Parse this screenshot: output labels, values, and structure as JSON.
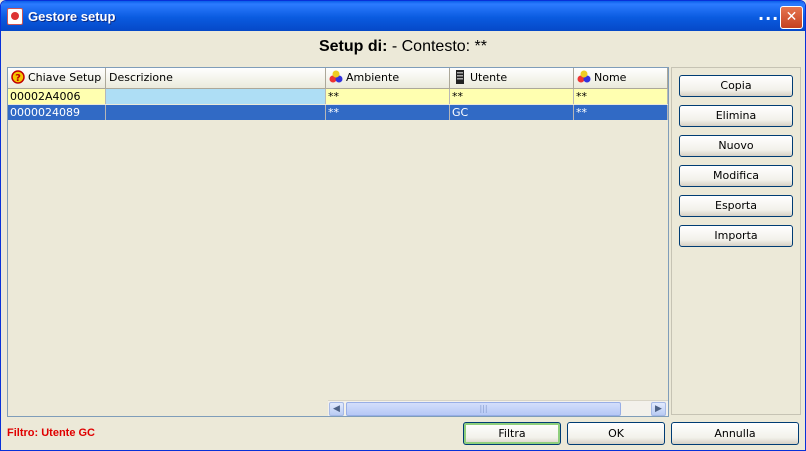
{
  "window": {
    "title": "Gestore setup",
    "menu_dots": "...",
    "close_glyph": "✕"
  },
  "heading": {
    "label": "Setup di:",
    "context": " - Contesto: **"
  },
  "table": {
    "columns": [
      {
        "label": "Chiave Setup",
        "icon": "question-icon"
      },
      {
        "label": "Descrizione",
        "icon": ""
      },
      {
        "label": "Ambiente",
        "icon": "colored-balls-icon"
      },
      {
        "label": "Utente",
        "icon": "user-server-icon"
      },
      {
        "label": "Nome",
        "icon": "colored-balls-icon"
      }
    ],
    "rows": [
      {
        "chiave": "00002A4006",
        "descrizione": "",
        "ambiente": "**",
        "utente": "**",
        "nome": "**",
        "selected": false
      },
      {
        "chiave": "0000024089",
        "descrizione": "",
        "ambiente": "**",
        "utente": "GC",
        "nome": "**",
        "selected": true
      }
    ]
  },
  "side_buttons": {
    "copia": "Copia",
    "elimina": "Elimina",
    "nuovo": "Nuovo",
    "modifica": "Modifica",
    "esporta": "Esporta",
    "importa": "Importa"
  },
  "footer": {
    "filter_text": "Filtro: Utente GC",
    "filtra": "Filtra",
    "ok": "OK",
    "annulla": "Annulla"
  },
  "colors": {
    "title_bar": "#0A5BE0",
    "selected_row": "#316AC5",
    "highlight_row": "#FFFFB0",
    "filter_text": "#E00000"
  }
}
